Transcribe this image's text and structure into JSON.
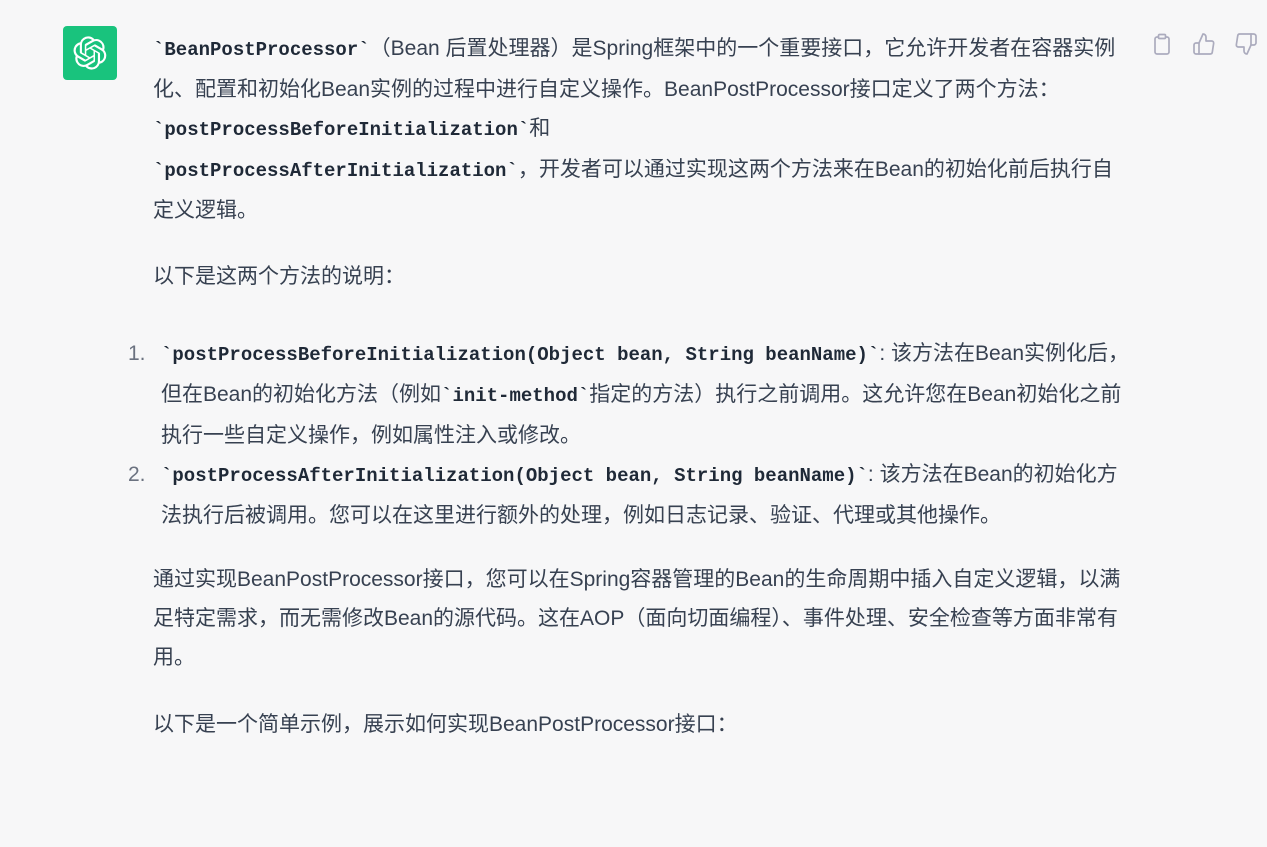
{
  "assistant": {
    "avatar_icon": "openai-logo-icon",
    "brand_color": "#19c37d"
  },
  "actions": {
    "copy_icon": "clipboard-icon",
    "like_icon": "thumbs-up-icon",
    "dislike_icon": "thumbs-down-icon"
  },
  "message": {
    "p1_code1": "`BeanPostProcessor`",
    "p1_text1": "（Bean 后置处理器）是Spring框架中的一个重要接口，它允许开发者在容器实例化、配置和初始化Bean实例的过程中进行自定义操作。BeanPostProcessor接口定义了两个方法：",
    "p1_code2": "`postProcessBeforeInitialization`",
    "p1_text2": "和",
    "p1_code3": "`postProcessAfterInitialization`",
    "p1_text3": "，开发者可以通过实现这两个方法来在Bean的初始化前后执行自定义逻辑。",
    "p2": "以下是这两个方法的说明：",
    "list": [
      {
        "num": "1.",
        "code": "`postProcessBeforeInitialization(Object bean, String beanName)`",
        "text1": ": 该方法在Bean实例化后，但在Bean的初始化方法（例如",
        "code2": "`init-method`",
        "text2": "指定的方法）执行之前调用。这允许您在Bean初始化之前执行一些自定义操作，例如属性注入或修改。"
      },
      {
        "num": "2.",
        "code": "`postProcessAfterInitialization(Object bean, String beanName)`",
        "text1": ": 该方法在Bean的初始化方法执行后被调用。您可以在这里进行额外的处理，例如日志记录、验证、代理或其他操作。"
      }
    ],
    "p3": "通过实现BeanPostProcessor接口，您可以在Spring容器管理的Bean的生命周期中插入自定义逻辑，以满足特定需求，而无需修改Bean的源代码。这在AOP（面向切面编程）、事件处理、安全检查等方面非常有用。",
    "p4": "以下是一个简单示例，展示如何实现BeanPostProcessor接口："
  }
}
